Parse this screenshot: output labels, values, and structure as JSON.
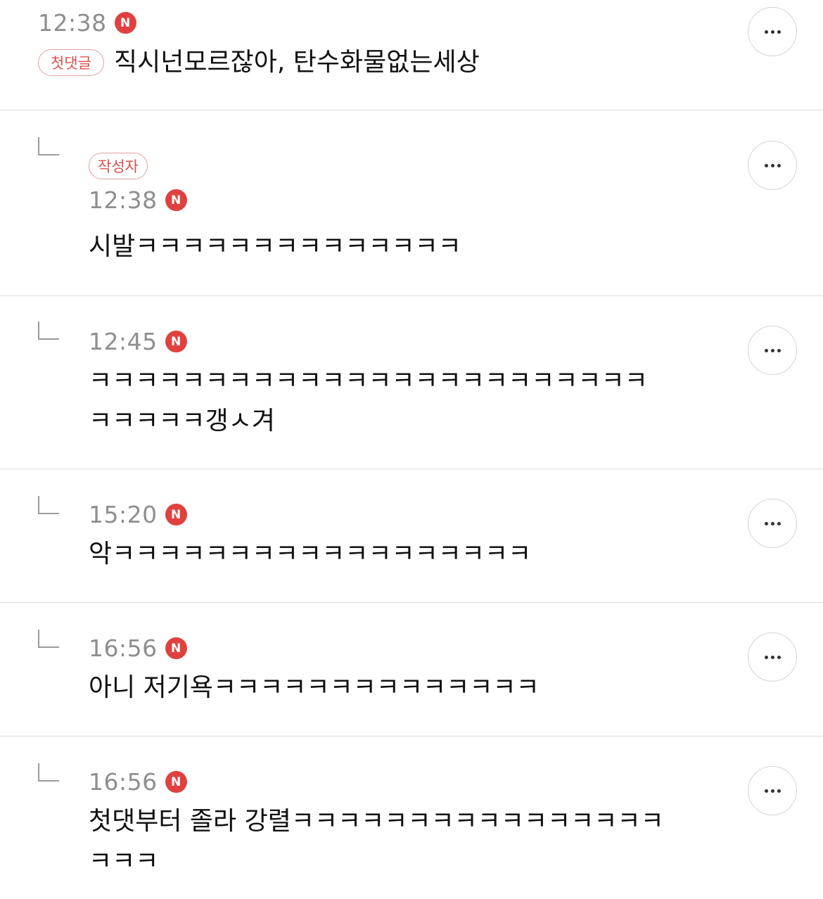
{
  "comments": [
    {
      "time": "12:38",
      "badge": "첫댓글",
      "text": "직시넌모르잖아, 탄수화물없는세상",
      "new_mark": "N"
    },
    {
      "time": "12:38",
      "badge": "작성자",
      "text": "시발ㅋㅋㅋㅋㅋㅋㅋㅋㅋㅋㅋㅋㅋㅋ",
      "new_mark": "N"
    },
    {
      "time": "12:45",
      "text": "ㅋㅋㅋㅋㅋㅋㅋㅋㅋㅋㅋㅋㅋㅋㅋㅋㅋㅋㅋㅋㅋㅋㅋㅋ\nㅋㅋㅋㅋㅋ갱ㅅ겨",
      "new_mark": "N"
    },
    {
      "time": "15:20",
      "text": "악ㅋㅋㅋㅋㅋㅋㅋㅋㅋㅋㅋㅋㅋㅋㅋㅋㅋㅋ",
      "new_mark": "N"
    },
    {
      "time": "16:56",
      "text": "아니 저기욕ㅋㅋㅋㅋㅋㅋㅋㅋㅋㅋㅋㅋㅋㅋ",
      "new_mark": "N"
    },
    {
      "time": "16:56",
      "text": "첫댓부터 졸라 강렬ㅋㅋㅋㅋㅋㅋㅋㅋㅋㅋㅋㅋㅋㅋㅋㅋ\nㅋㅋㅋ",
      "new_mark": "N"
    }
  ],
  "icons": {
    "more": "more-horizontal-icon",
    "reply": "reply-arrow-icon"
  },
  "colors": {
    "new_badge": "#e0413f",
    "label_badge_text": "#d9534f",
    "label_badge_border": "#e3a3a3",
    "time": "#8e8e8e",
    "divider": "#dcdcdc"
  }
}
